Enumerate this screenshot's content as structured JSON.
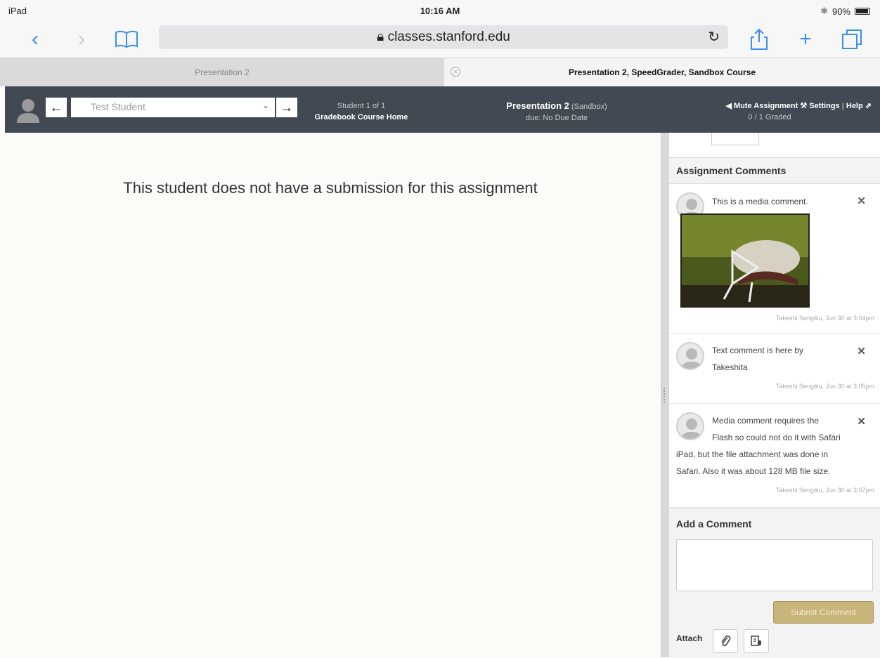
{
  "status_bar": {
    "device": "iPad",
    "time": "10:16 AM",
    "battery": "90%"
  },
  "browser": {
    "url": "classes.stanford.edu",
    "tabs": [
      {
        "label": "Presentation 2"
      },
      {
        "label": "Presentation 2, SpeedGrader, Sandbox Course"
      }
    ]
  },
  "header": {
    "student_select": "Test Student",
    "student_count": "Student 1 of 1",
    "gradebook_link": "Gradebook Course Home",
    "assignment_title": "Presentation 2",
    "course_tag": "(Sandbox)",
    "due": "due: No Due Date",
    "mute": "Mute Assignment",
    "settings": "Settings",
    "help": "Help",
    "graded": "0 / 1 Graded"
  },
  "main": {
    "message": "This student does not have a submission for this assignment"
  },
  "panel": {
    "comments_title": "Assignment Comments",
    "comments": [
      {
        "text": "This is a media comment.",
        "meta": "Takeshi Sengiku, Jun 30 at 3:04pm"
      },
      {
        "text": "Text comment is here by Takeshita",
        "meta": "Takeshi Sengiku, Jun 30 at 3:05pm"
      },
      {
        "text_line1": "Media comment requires the",
        "text_line2": "Flash so could not do it with Safari",
        "text_line3": "iPad, but the file attachment was done in",
        "text_line4": "Safari. Also it was about 128 MB file size.",
        "meta": "Takeshi Sengiku, Jun 30 at 3:07pm"
      }
    ],
    "add_comment_title": "Add a Comment",
    "submit_label": "Submit Comment",
    "attach_label": "Attach"
  }
}
